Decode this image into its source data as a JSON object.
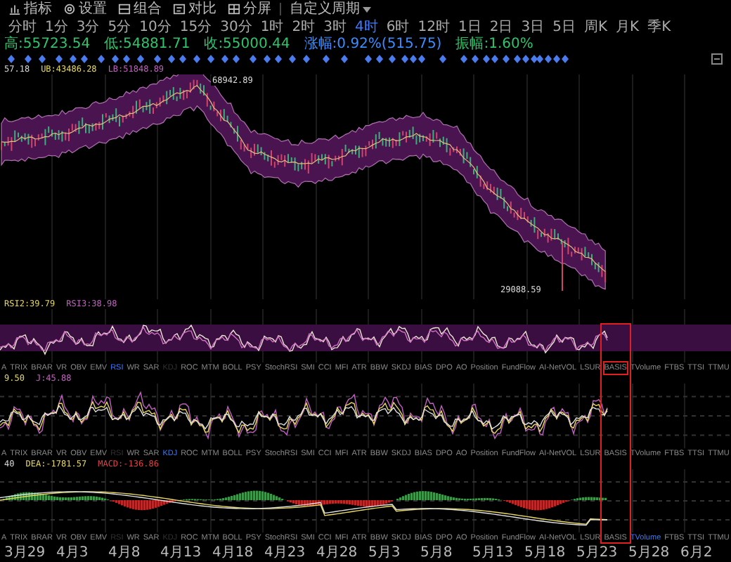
{
  "toolbar": {
    "tools": [
      {
        "kind": "indicator",
        "label": "指标"
      },
      {
        "kind": "settings",
        "label": "设置"
      },
      {
        "kind": "combo",
        "label": "组合"
      },
      {
        "kind": "compare",
        "label": "对比"
      },
      {
        "kind": "split",
        "label": "分屏"
      }
    ],
    "custom_period": "自定义周期",
    "periods": [
      {
        "label": "分时",
        "selected": false
      },
      {
        "label": "1分",
        "selected": false
      },
      {
        "label": "3分",
        "selected": false
      },
      {
        "label": "5分",
        "selected": false
      },
      {
        "label": "10分",
        "selected": false
      },
      {
        "label": "15分",
        "selected": false
      },
      {
        "label": "30分",
        "selected": false
      },
      {
        "label": "1时",
        "selected": false
      },
      {
        "label": "2时",
        "selected": false
      },
      {
        "label": "3时",
        "selected": false
      },
      {
        "label": "4时",
        "selected": true
      },
      {
        "label": "6时",
        "selected": false
      },
      {
        "label": "12时",
        "selected": false
      },
      {
        "label": "1日",
        "selected": false
      },
      {
        "label": "2日",
        "selected": false
      },
      {
        "label": "3日",
        "selected": false
      },
      {
        "label": "5日",
        "selected": false
      },
      {
        "label": "周K",
        "selected": false
      },
      {
        "label": "月K",
        "selected": false
      },
      {
        "label": "季K",
        "selected": false
      }
    ]
  },
  "info": [
    {
      "text": "高:55723.54",
      "color": "#2fc46b"
    },
    {
      "text": "低:54881.71",
      "color": "#2fc46b"
    },
    {
      "text": "收:55000.44",
      "color": "#2fc46b"
    },
    {
      "text": "涨幅:0.92%(515.75)",
      "color": "#3b8cff"
    },
    {
      "text": "振幅:1.60%",
      "color": "#2fc46b"
    }
  ],
  "main_chart": {
    "labels": [
      {
        "text": "57.18",
        "color": "#d8d8d8"
      },
      {
        "text": "UB:43486.28",
        "color": "#e8d860"
      },
      {
        "text": "LB:51848.89",
        "color": "#c060c0"
      }
    ],
    "high_label": "68942.89",
    "low_label": "29088.59"
  },
  "panes": [
    {
      "kind": "rsi",
      "labels": [
        {
          "text": "RSI2:39.79",
          "color": "#e8d860"
        },
        {
          "text": "RSI3:38.98",
          "color": "#c060c0"
        }
      ],
      "tabs": [
        {
          "label": "A",
          "selected": false,
          "dim": false,
          "outlined": false
        },
        {
          "label": "TRIX",
          "selected": false,
          "dim": false,
          "outlined": false
        },
        {
          "label": "BRAR",
          "selected": false,
          "dim": false,
          "outlined": false
        },
        {
          "label": "VR",
          "selected": false,
          "dim": false,
          "outlined": false
        },
        {
          "label": "OBV",
          "selected": false,
          "dim": false,
          "outlined": false
        },
        {
          "label": "EMV",
          "selected": false,
          "dim": false,
          "outlined": false
        },
        {
          "label": "RSI",
          "selected": true,
          "dim": false,
          "outlined": false
        },
        {
          "label": "WR",
          "selected": false,
          "dim": false,
          "outlined": false
        },
        {
          "label": "SAR",
          "selected": false,
          "dim": false,
          "outlined": false
        },
        {
          "label": "KDJ",
          "selected": false,
          "dim": true,
          "outlined": false
        },
        {
          "label": "ROC",
          "selected": false,
          "dim": false,
          "outlined": false
        },
        {
          "label": "MTM",
          "selected": false,
          "dim": false,
          "outlined": false
        },
        {
          "label": "BOLL",
          "selected": false,
          "dim": false,
          "outlined": false
        },
        {
          "label": "PSY",
          "selected": false,
          "dim": false,
          "outlined": false
        },
        {
          "label": "StochRSI",
          "selected": false,
          "dim": false,
          "outlined": false
        },
        {
          "label": "SMI",
          "selected": false,
          "dim": false,
          "outlined": false
        },
        {
          "label": "CCI",
          "selected": false,
          "dim": false,
          "outlined": false
        },
        {
          "label": "MFI",
          "selected": false,
          "dim": false,
          "outlined": false
        },
        {
          "label": "ATR",
          "selected": false,
          "dim": false,
          "outlined": false
        },
        {
          "label": "BBW",
          "selected": false,
          "dim": false,
          "outlined": false
        },
        {
          "label": "SKDJ",
          "selected": false,
          "dim": false,
          "outlined": false
        },
        {
          "label": "BIAS",
          "selected": false,
          "dim": false,
          "outlined": false
        },
        {
          "label": "DPO",
          "selected": false,
          "dim": false,
          "outlined": false
        },
        {
          "label": "AO",
          "selected": false,
          "dim": false,
          "outlined": false
        },
        {
          "label": "Position",
          "selected": false,
          "dim": false,
          "outlined": false
        },
        {
          "label": "FundFlow",
          "selected": false,
          "dim": false,
          "outlined": false
        },
        {
          "label": "AI-NetVOL",
          "selected": false,
          "dim": false,
          "outlined": false
        },
        {
          "label": "LSUR",
          "selected": false,
          "dim": false,
          "outlined": false
        },
        {
          "label": "BASIS",
          "selected": false,
          "dim": false,
          "outlined": true
        },
        {
          "label": "TVolume",
          "selected": false,
          "dim": false,
          "outlined": false
        },
        {
          "label": "FTBS",
          "selected": false,
          "dim": false,
          "outlined": false
        },
        {
          "label": "TTSI",
          "selected": false,
          "dim": false,
          "outlined": false
        },
        {
          "label": "TTMU",
          "selected": false,
          "dim": false,
          "outlined": false
        }
      ]
    },
    {
      "kind": "kdj",
      "labels": [
        {
          "text": "9.50",
          "color": "#e8d860"
        },
        {
          "text": "J:45.88",
          "color": "#c060c0"
        }
      ],
      "tabs": [
        {
          "label": "A",
          "selected": false,
          "dim": false
        },
        {
          "label": "TRIX",
          "selected": false,
          "dim": false
        },
        {
          "label": "BRAR",
          "selected": false,
          "dim": false
        },
        {
          "label": "VR",
          "selected": false,
          "dim": false
        },
        {
          "label": "OBV",
          "selected": false,
          "dim": false
        },
        {
          "label": "EMV",
          "selected": false,
          "dim": false
        },
        {
          "label": "RSI",
          "selected": false,
          "dim": true
        },
        {
          "label": "WR",
          "selected": false,
          "dim": false
        },
        {
          "label": "SAR",
          "selected": false,
          "dim": false
        },
        {
          "label": "KDJ",
          "selected": true,
          "dim": false
        },
        {
          "label": "ROC",
          "selected": false,
          "dim": false
        },
        {
          "label": "MTM",
          "selected": false,
          "dim": false
        },
        {
          "label": "BOLL",
          "selected": false,
          "dim": false
        },
        {
          "label": "PSY",
          "selected": false,
          "dim": false
        },
        {
          "label": "StochRSI",
          "selected": false,
          "dim": false
        },
        {
          "label": "SMI",
          "selected": false,
          "dim": false
        },
        {
          "label": "CCI",
          "selected": false,
          "dim": false
        },
        {
          "label": "MFI",
          "selected": false,
          "dim": false
        },
        {
          "label": "ATR",
          "selected": false,
          "dim": false
        },
        {
          "label": "BBW",
          "selected": false,
          "dim": false
        },
        {
          "label": "SKDJ",
          "selected": false,
          "dim": false
        },
        {
          "label": "BIAS",
          "selected": false,
          "dim": false
        },
        {
          "label": "DPO",
          "selected": false,
          "dim": false
        },
        {
          "label": "AO",
          "selected": false,
          "dim": false
        },
        {
          "label": "Position",
          "selected": false,
          "dim": false
        },
        {
          "label": "FundFlow",
          "selected": false,
          "dim": false
        },
        {
          "label": "AI-NetVOL",
          "selected": false,
          "dim": false
        },
        {
          "label": "LSUR",
          "selected": false,
          "dim": false
        },
        {
          "label": "BASIS",
          "selected": false,
          "dim": false
        },
        {
          "label": "TVolume",
          "selected": false,
          "dim": false
        },
        {
          "label": "FTBS",
          "selected": false,
          "dim": false
        },
        {
          "label": "TTSI",
          "selected": false,
          "dim": false
        },
        {
          "label": "TTMU",
          "selected": false,
          "dim": false
        }
      ]
    },
    {
      "kind": "macd",
      "labels": [
        {
          "text": "40",
          "color": "#d8d8d8"
        },
        {
          "text": "DEA:-1781.57",
          "color": "#e8d860"
        },
        {
          "text": "MACD:-136.86",
          "color": "#e04040"
        }
      ],
      "tabs": [
        {
          "label": "A",
          "selected": false,
          "dim": false
        },
        {
          "label": "TRIX",
          "selected": false,
          "dim": false
        },
        {
          "label": "BRAR",
          "selected": false,
          "dim": false
        },
        {
          "label": "VR",
          "selected": false,
          "dim": false
        },
        {
          "label": "OBV",
          "selected": false,
          "dim": false
        },
        {
          "label": "EMV",
          "selected": false,
          "dim": false
        },
        {
          "label": "RSI",
          "selected": false,
          "dim": true
        },
        {
          "label": "WR",
          "selected": false,
          "dim": false
        },
        {
          "label": "SAR",
          "selected": false,
          "dim": false
        },
        {
          "label": "KDJ",
          "selected": false,
          "dim": true
        },
        {
          "label": "ROC",
          "selected": false,
          "dim": false
        },
        {
          "label": "MTM",
          "selected": false,
          "dim": false
        },
        {
          "label": "BOLL",
          "selected": false,
          "dim": false
        },
        {
          "label": "PSY",
          "selected": false,
          "dim": false
        },
        {
          "label": "StochRSI",
          "selected": false,
          "dim": false
        },
        {
          "label": "SMI",
          "selected": false,
          "dim": false
        },
        {
          "label": "CCI",
          "selected": false,
          "dim": false
        },
        {
          "label": "MFI",
          "selected": false,
          "dim": false
        },
        {
          "label": "ATR",
          "selected": false,
          "dim": false
        },
        {
          "label": "BBW",
          "selected": false,
          "dim": false
        },
        {
          "label": "SKDJ",
          "selected": false,
          "dim": false
        },
        {
          "label": "BIAS",
          "selected": false,
          "dim": false
        },
        {
          "label": "DPO",
          "selected": false,
          "dim": false
        },
        {
          "label": "AO",
          "selected": false,
          "dim": false
        },
        {
          "label": "Position",
          "selected": false,
          "dim": false
        },
        {
          "label": "FundFlow",
          "selected": false,
          "dim": false
        },
        {
          "label": "AI-NetVOL",
          "selected": false,
          "dim": false
        },
        {
          "label": "LSUR",
          "selected": false,
          "dim": false
        },
        {
          "label": "BASIS",
          "selected": false,
          "dim": false
        },
        {
          "label": "TVolume",
          "selected": true,
          "dim": false
        },
        {
          "label": "FTBS",
          "selected": false,
          "dim": false
        },
        {
          "label": "TTSI",
          "selected": false,
          "dim": false
        },
        {
          "label": "TTMU",
          "selected": false,
          "dim": false
        }
      ]
    }
  ],
  "dates": [
    "3月29",
    "4月3",
    "4月8",
    "4月13",
    "4月18",
    "4月23",
    "4月28",
    "5月3",
    "5月8",
    "5月13",
    "5月18",
    "5月23",
    "5月28",
    "6月2"
  ]
}
